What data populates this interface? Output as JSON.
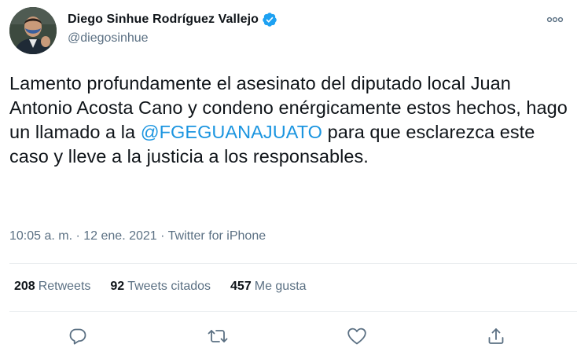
{
  "user": {
    "display_name": "Diego Sinhue Rodríguez Vallejo",
    "handle": "@diegosinhue",
    "verified": true
  },
  "tweet": {
    "text_before": "Lamento profundamente el asesinato del diputado local Juan Antonio Acosta Cano y condeno enérgicamente estos hechos, hago un llamado a la ",
    "mention": "@FGEGUANAJUATO",
    "text_after": " para que esclarezca este caso y lleve a la justicia a los responsables."
  },
  "meta": {
    "time": "10:05 a. m.",
    "separator": " · ",
    "date": "12 ene. 2021",
    "source": "Twitter for iPhone"
  },
  "stats": {
    "retweets_count": "208",
    "retweets_label": "Retweets",
    "quotes_count": "92",
    "quotes_label": "Tweets citados",
    "likes_count": "457",
    "likes_label": "Me gusta"
  },
  "icons": {
    "verified": "verified-badge-icon",
    "more": "more-dots-icon",
    "reply": "reply-icon",
    "retweet": "retweet-icon",
    "like": "heart-icon",
    "share": "share-icon"
  },
  "colors": {
    "link": "#1b95e0",
    "verified": "#1da1f2",
    "secondary_text": "#5b7083",
    "icon": "#5b7083",
    "divider": "#ebeef0"
  }
}
